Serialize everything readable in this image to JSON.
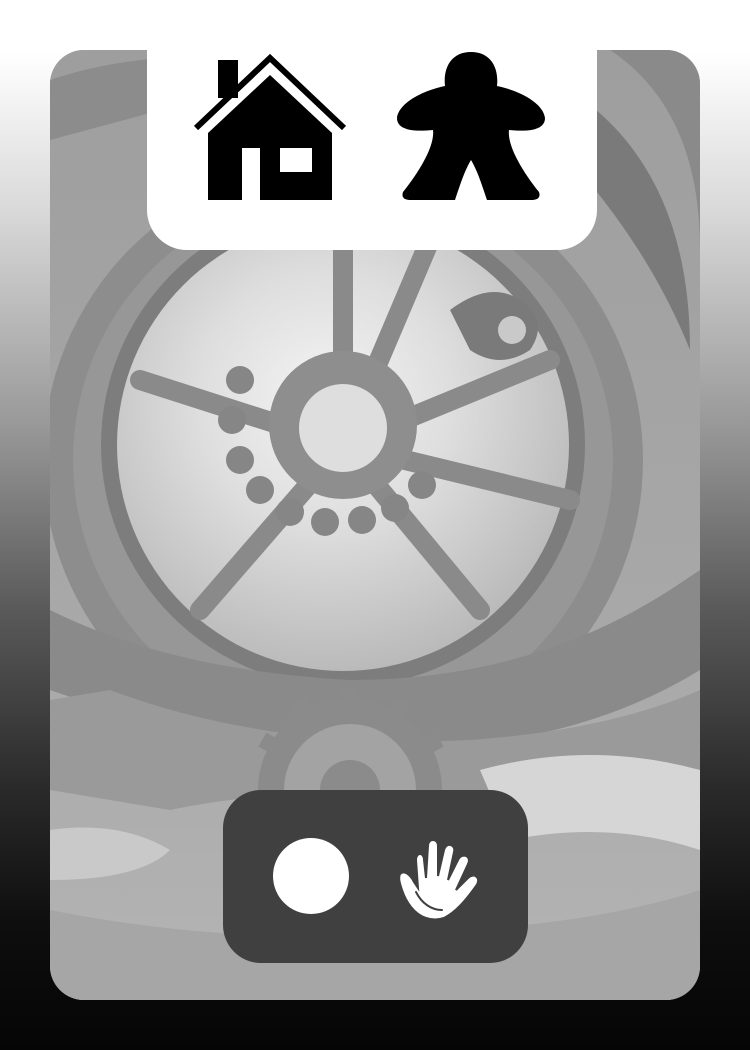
{
  "card": {
    "art_icon": "clockwork-gears-illustration",
    "top_icons": [
      "house-icon",
      "meeple-icon"
    ],
    "bottom_icons": [
      "circle-token-icon",
      "hand-icon"
    ]
  },
  "colors": {
    "top_panel": "#ffffff",
    "bottom_panel": "#404040",
    "icon_dark": "#000000",
    "icon_light": "#ffffff",
    "art_tone": "#a9a9a9"
  }
}
